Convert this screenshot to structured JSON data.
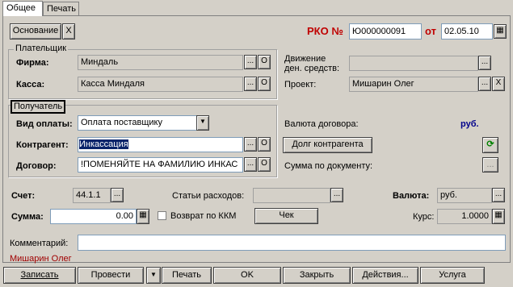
{
  "tabs": [
    {
      "label": "Общее",
      "active": true
    },
    {
      "label": "Печать",
      "active": false
    }
  ],
  "header": {
    "osnovanie_label": "Основание",
    "clear_label": "X",
    "rko_label": "РКО №",
    "number_value": "Ю000000091",
    "from_label": "от",
    "date_value": "02.05.10",
    "accent_color": "#c00000"
  },
  "payer": {
    "group_title": "Плательщик",
    "firm_label": "Фирма:",
    "firm_value": "Миндаль",
    "kassa_label": "Касса:",
    "kassa_value": "Касса Миндаля",
    "movement_label_line1": "Движение",
    "movement_label_line2": "ден. средств:",
    "movement_value": "",
    "project_label": "Проект:",
    "project_value": "Мишарин Олег"
  },
  "recipient": {
    "group_title": "Получатель",
    "payment_type_label": "Вид оплаты:",
    "payment_type_value": "Оплата поставщику",
    "contractor_label": "Контрагент:",
    "contractor_value": "Инкассация",
    "contract_label": "Договор:",
    "contract_value": "!ПОМЕНЯЙТЕ НА ФАМИЛИЮ ИНКАС",
    "contract_currency_label": "Валюта договора:",
    "contract_currency_value": "руб.",
    "debt_button_label": "Долг контрагента",
    "doc_sum_label": "Сумма по документу:"
  },
  "accounting": {
    "account_label": "Счет:",
    "account_value": "44.1.1",
    "expenses_label": "Статьи расходов:",
    "expenses_value": "",
    "currency_label": "Валюта:",
    "currency_value": "руб.",
    "sum_label": "Сумма:",
    "sum_value": "0.00",
    "return_kkm_label": "Возврат по ККМ",
    "check_button_label": "Чек",
    "rate_label": "Курс:",
    "rate_value": "1.0000"
  },
  "comment": {
    "label": "Комментарий:",
    "value": "",
    "author": "Мишарин Олег",
    "author_color": "#a00000"
  },
  "footer": {
    "write_label": "Записать",
    "post_label": "Провести",
    "print_label": "Печать",
    "ok_label": "OK",
    "close_label": "Закрыть",
    "actions_label": "Действия...",
    "service_label": "Услуга"
  },
  "small_button_glyphs": {
    "ellipsis": "...",
    "o_button": "О",
    "x_button": "X",
    "dropdown": "▼"
  }
}
